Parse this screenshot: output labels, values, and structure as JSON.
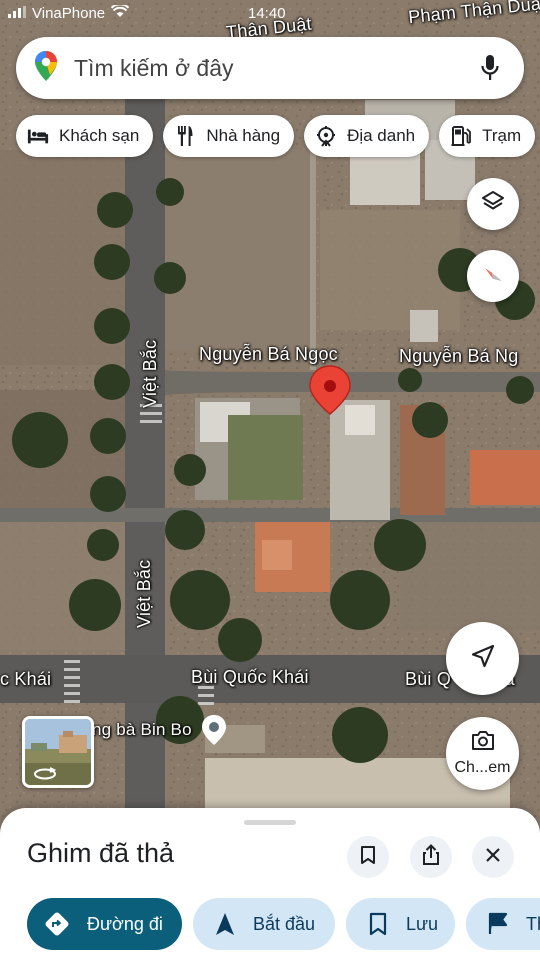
{
  "status_bar": {
    "carrier": "VinaPhone",
    "time": "14:40"
  },
  "search": {
    "placeholder": "Tìm kiếm ở đây"
  },
  "chips": [
    {
      "label": "Khách sạn",
      "icon": "bed-icon"
    },
    {
      "label": "Nhà hàng",
      "icon": "restaurant-icon"
    },
    {
      "label": "Địa danh",
      "icon": "landmark-icon"
    },
    {
      "label": "Trạm",
      "icon": "gas-station-icon"
    }
  ],
  "map": {
    "road_labels": {
      "top1": "Thân Duật",
      "top2": "Phạm Thận Duật",
      "ngoc1": "Nguyễn Bá Ngọc",
      "ngoc2": "Nguyễn Bá Ng",
      "vietbac1": "Việt Bắc",
      "vietbac2": "Việt Bắc",
      "khai1": "c Khái",
      "khai2": "Bùi Quốc Khái",
      "khai3": "Bùi Q      Khá",
      "place": "ng bà Bin Bo"
    },
    "camera_label": "Ch...em"
  },
  "sheet": {
    "title": "Ghim đã thả",
    "actions": [
      {
        "label": "Đường đi",
        "icon": "directions-icon"
      },
      {
        "label": "Bắt đầu",
        "icon": "navigation-arrow-icon"
      },
      {
        "label": "Lưu",
        "icon": "bookmark-icon"
      },
      {
        "label": "Th",
        "icon": "flag-icon"
      }
    ]
  },
  "colors": {
    "accent": "#0b5f7a",
    "action_bg": "#d3e6f5",
    "pin": "#ea4335"
  }
}
